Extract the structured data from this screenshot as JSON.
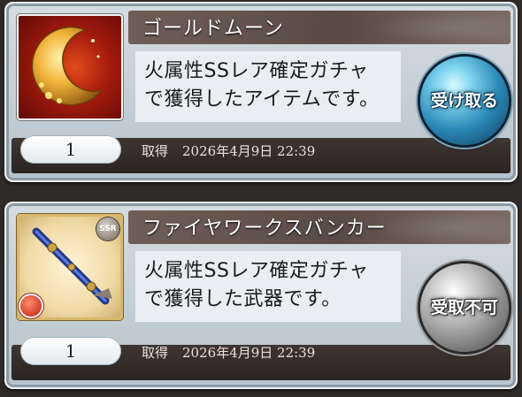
{
  "items": [
    {
      "name": "ゴールドムーン",
      "description": [
        "火属性SSレア確定ガチャ",
        "で獲得したアイテムです。"
      ],
      "quantity": "1",
      "acquired_label": "取得",
      "acquired_date": "2026年4月9日 22:39",
      "button_label": "受け取る",
      "thumbnail_icon": "gold-moon-icon",
      "button_state": "active"
    },
    {
      "name": "ファイヤワークスバンカー",
      "description": [
        "火属性SSレア確定ガチャ",
        "で獲得した武器です。"
      ],
      "quantity": "1",
      "acquired_label": "取得",
      "acquired_date": "2026年4月9日 22:39",
      "button_label": "受取不可",
      "rarity_badge": "SSR",
      "thumbnail_icon": "fireworks-bunker-weapon-icon",
      "element_icon": "fire-element-icon",
      "button_state": "disabled"
    }
  ],
  "colors": {
    "active_button": "#2b88b8",
    "disabled_button": "#8d8d8d",
    "moon_background": "#a31a0c",
    "moon_gold": "#f2b43a"
  }
}
